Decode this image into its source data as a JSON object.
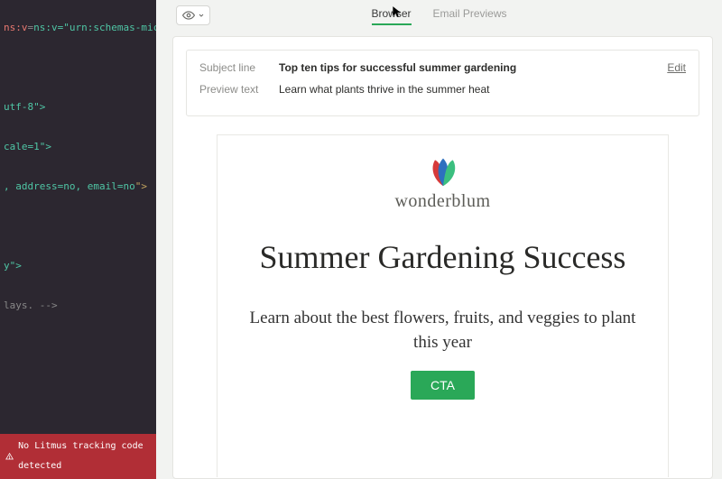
{
  "code": {
    "l1": "ns:v=\"urn:schemas-microsoft-",
    "l2": "utf-8\">",
    "l3": "cale=1\">",
    "l4a": ", address=no, email=no",
    "l4b": "\">",
    "l5": "y\">",
    "l6": "lays. -->"
  },
  "warning": "No Litmus tracking code detected",
  "tabs": {
    "browser": "Browser",
    "email_previews": "Email Previews"
  },
  "subject_card": {
    "subject_label": "Subject line",
    "subject_value": "Top ten tips for successful summer gardening",
    "preview_label": "Preview text",
    "preview_value": "Learn what plants thrive in the summer heat",
    "edit": "Edit"
  },
  "email": {
    "brand": "wonderblum",
    "headline": "Summer Gardening Success",
    "subhead": "Learn about the best flowers, fruits, and veggies to plant this year",
    "cta": "CTA"
  }
}
